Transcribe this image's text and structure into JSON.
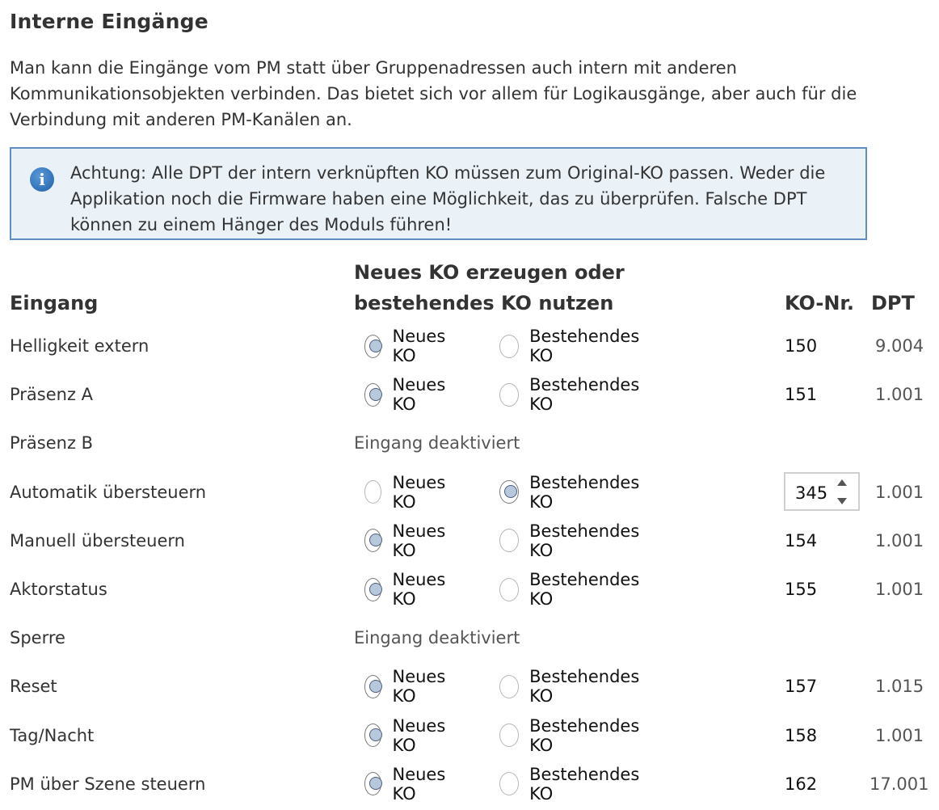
{
  "page_title": "Interne Eingänge",
  "description": "Man kann die Eingänge vom PM statt über Gruppenadressen auch intern mit anderen Kommunikationsobjekten verbinden. Das bietet sich vor allem für Logikausgänge, aber auch für die Verbindung mit anderen PM-Kanälen an.",
  "info_box": {
    "icon": "info-icon",
    "text": "Achtung: Alle DPT der intern verknüpften KO müssen zum Original-KO passen. Weder die Applikation noch die Firmware haben eine Möglichkeit, das zu überprüfen. Falsche DPT können zu einem Hänger des Moduls führen!"
  },
  "table": {
    "headers": {
      "eingang": "Eingang",
      "choice_line1": "Neues KO erzeugen oder",
      "choice_line2": "bestehendes KO nutzen",
      "ko_nr": "KO-Nr.",
      "dpt": "DPT"
    },
    "option_new": "Neues KO",
    "option_existing": "Bestehendes KO",
    "disabled_text": "Eingang deaktiviert",
    "rows": [
      {
        "label": "Helligkeit extern",
        "selected": "new",
        "ko": "150",
        "dpt": "9.004"
      },
      {
        "label": "Präsenz A",
        "selected": "new",
        "ko": "151",
        "dpt": "1.001"
      },
      {
        "label": "Präsenz B",
        "disabled": true
      },
      {
        "label": "Automatik übersteuern",
        "selected": "existing",
        "ko": "345",
        "dpt": "1.001"
      },
      {
        "label": "Manuell übersteuern",
        "selected": "new",
        "ko": "154",
        "dpt": "1.001"
      },
      {
        "label": "Aktorstatus",
        "selected": "new",
        "ko": "155",
        "dpt": "1.001"
      },
      {
        "label": "Sperre",
        "disabled": true
      },
      {
        "label": "Reset",
        "selected": "new",
        "ko": "157",
        "dpt": "1.015"
      },
      {
        "label": "Tag/Nacht",
        "selected": "new",
        "ko": "158",
        "dpt": "1.001"
      },
      {
        "label": "PM über Szene steuern",
        "selected": "new",
        "ko": "162",
        "dpt": "17.001"
      }
    ]
  }
}
